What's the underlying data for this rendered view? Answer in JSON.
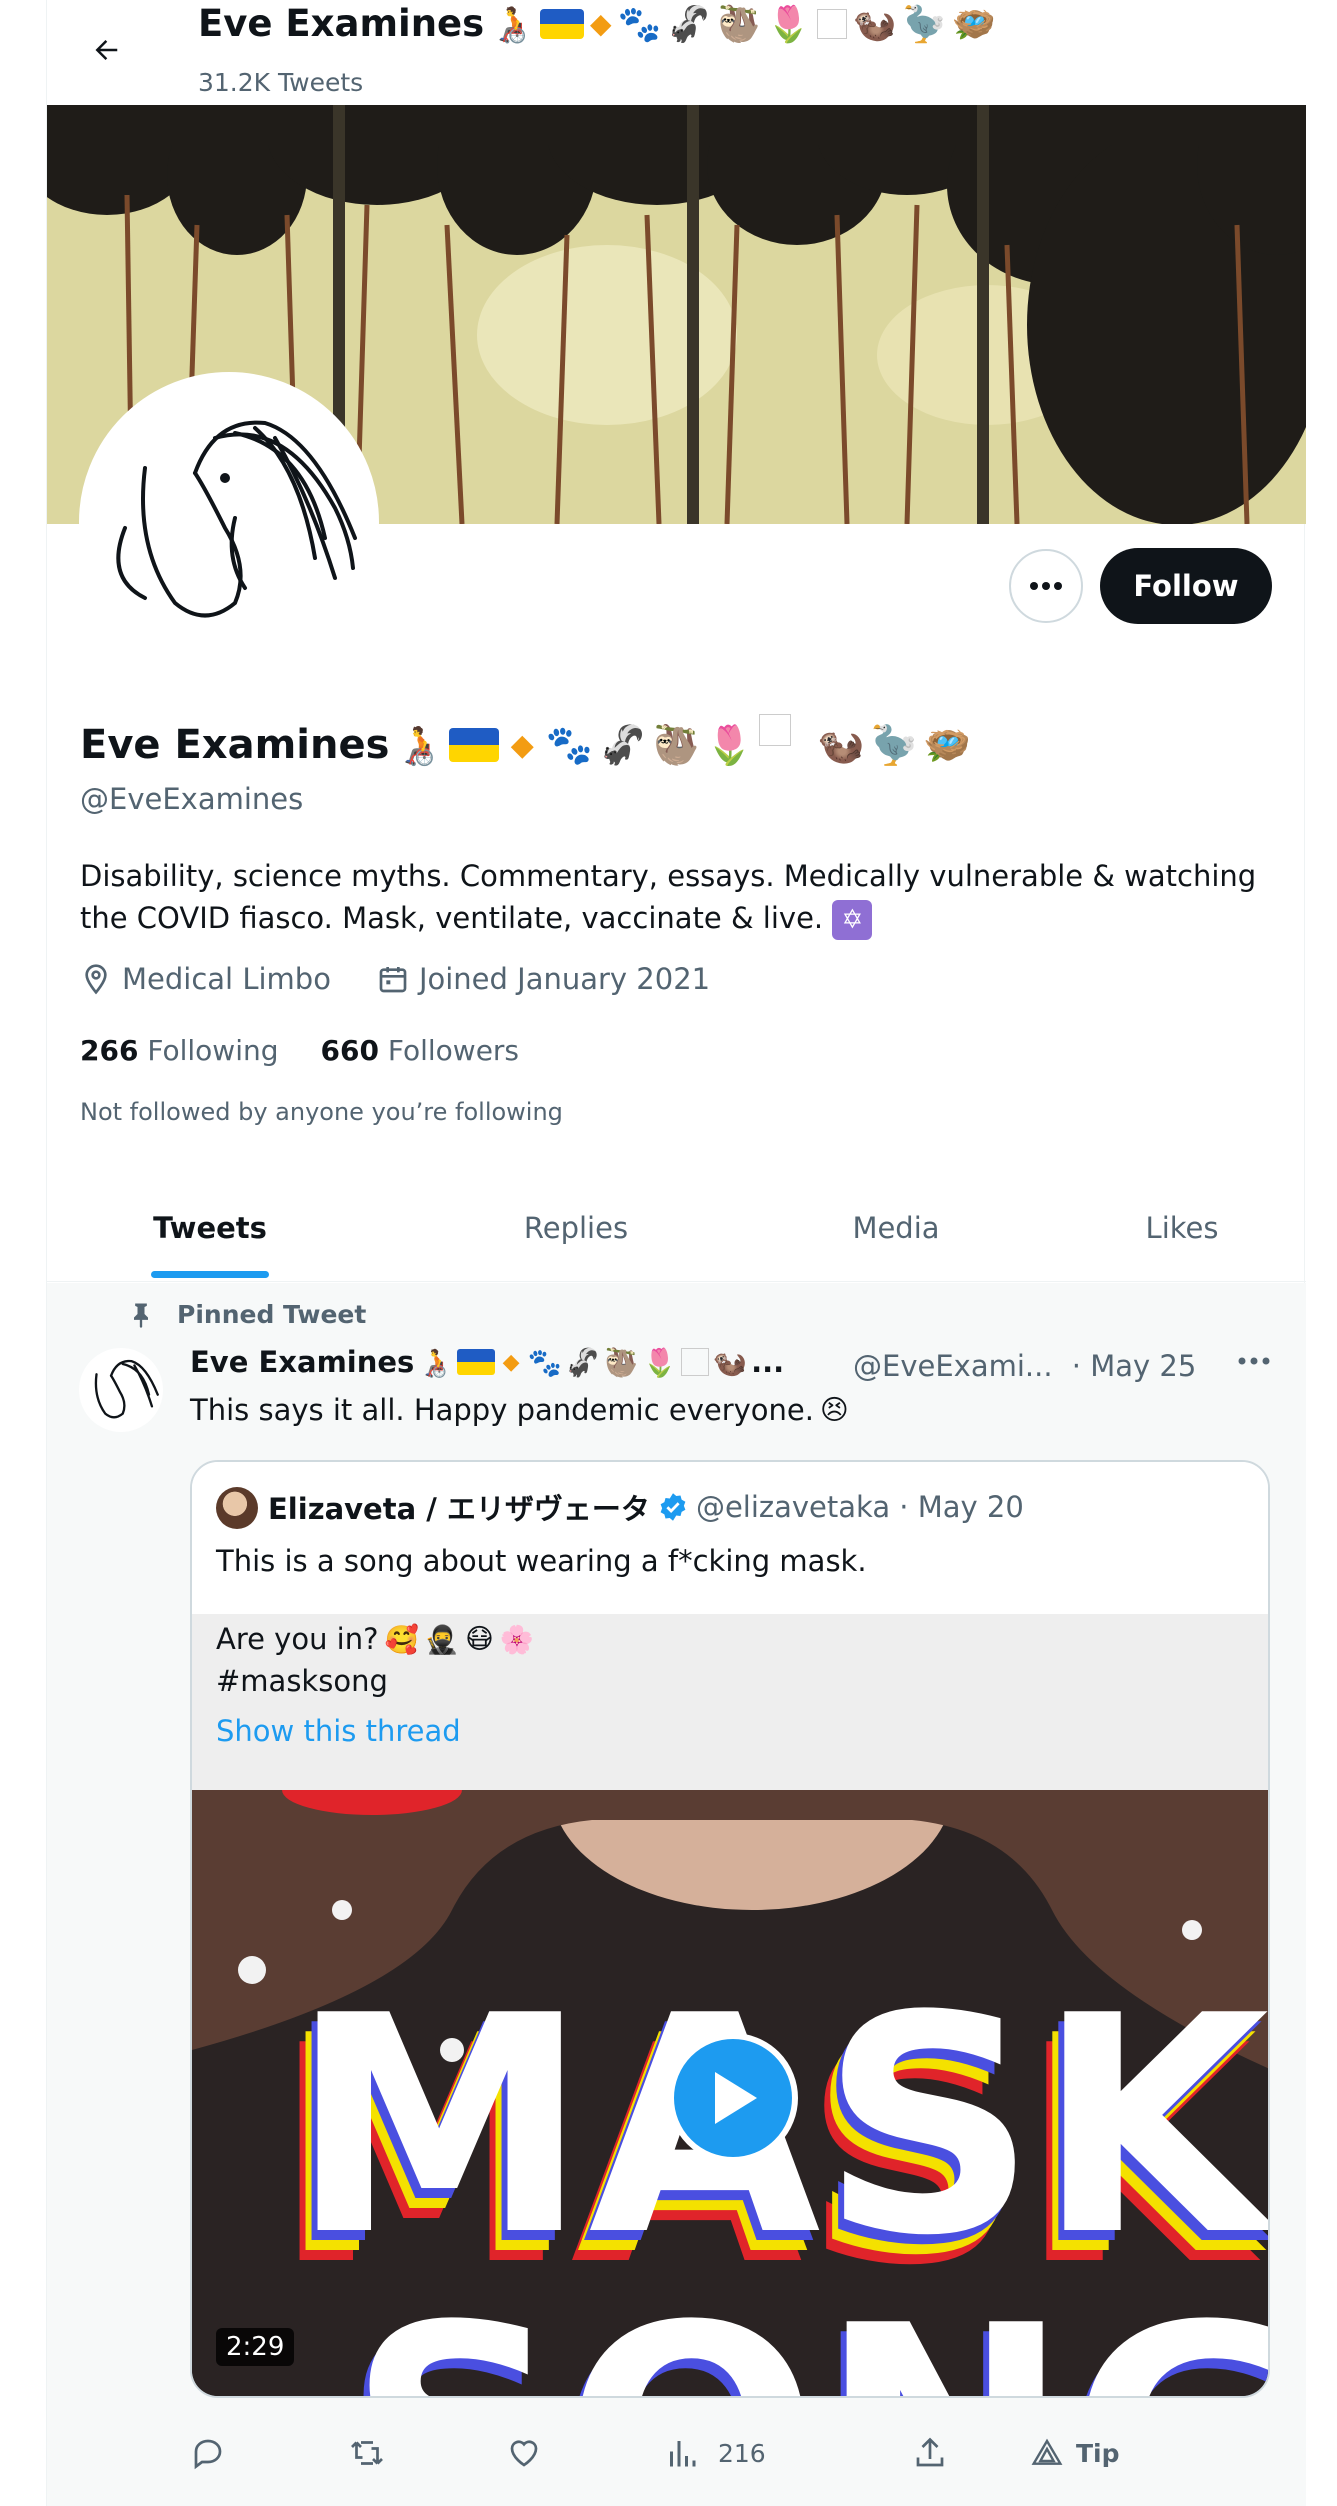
{
  "header": {
    "title": "Eve Examines",
    "tweet_count": "31.2K Tweets"
  },
  "profile": {
    "name": "Eve Examines",
    "handle": "@EveExamines",
    "bio": "Disability, science myths. Commentary, essays. Medically vulnerable & watching the COVID fiasco. Mask, ventilate, vaccinate & live.",
    "location": "Medical Limbo",
    "joined": "Joined January 2021",
    "following_count": "266",
    "following_label": "Following",
    "followers_count": "660",
    "followers_label": "Followers",
    "not_followed_note": "Not followed by anyone you’re following",
    "follow_label": "Follow"
  },
  "tabs": [
    {
      "label": "Tweets",
      "active": true
    },
    {
      "label": "Replies",
      "active": false
    },
    {
      "label": "Media",
      "active": false
    },
    {
      "label": "Likes",
      "active": false
    }
  ],
  "tweet": {
    "pinned_label": "Pinned Tweet",
    "author_name": "Eve Examines",
    "ellipsis": "...",
    "handle": "@EveExami...",
    "date": "· May 25",
    "text": "This says it all. Happy pandemic everyone.",
    "quote": {
      "author_name": "Elizaveta / エリザヴェータ",
      "handle_date": "@elizavetaka · May 20",
      "line1": "This is a song about wearing a f*cking mask.",
      "line2": "Are you in?",
      "line3": "#masksong",
      "show_thread": "Show this thread",
      "video_duration": "2:29",
      "video_title": "MASK SONG"
    },
    "actions": {
      "views": "216",
      "tip": "Tip"
    }
  },
  "colors": {
    "accent": "#1d9bf0",
    "text_primary": "#0f1419",
    "text_secondary": "#536471",
    "follow_bg": "#0f1419"
  }
}
